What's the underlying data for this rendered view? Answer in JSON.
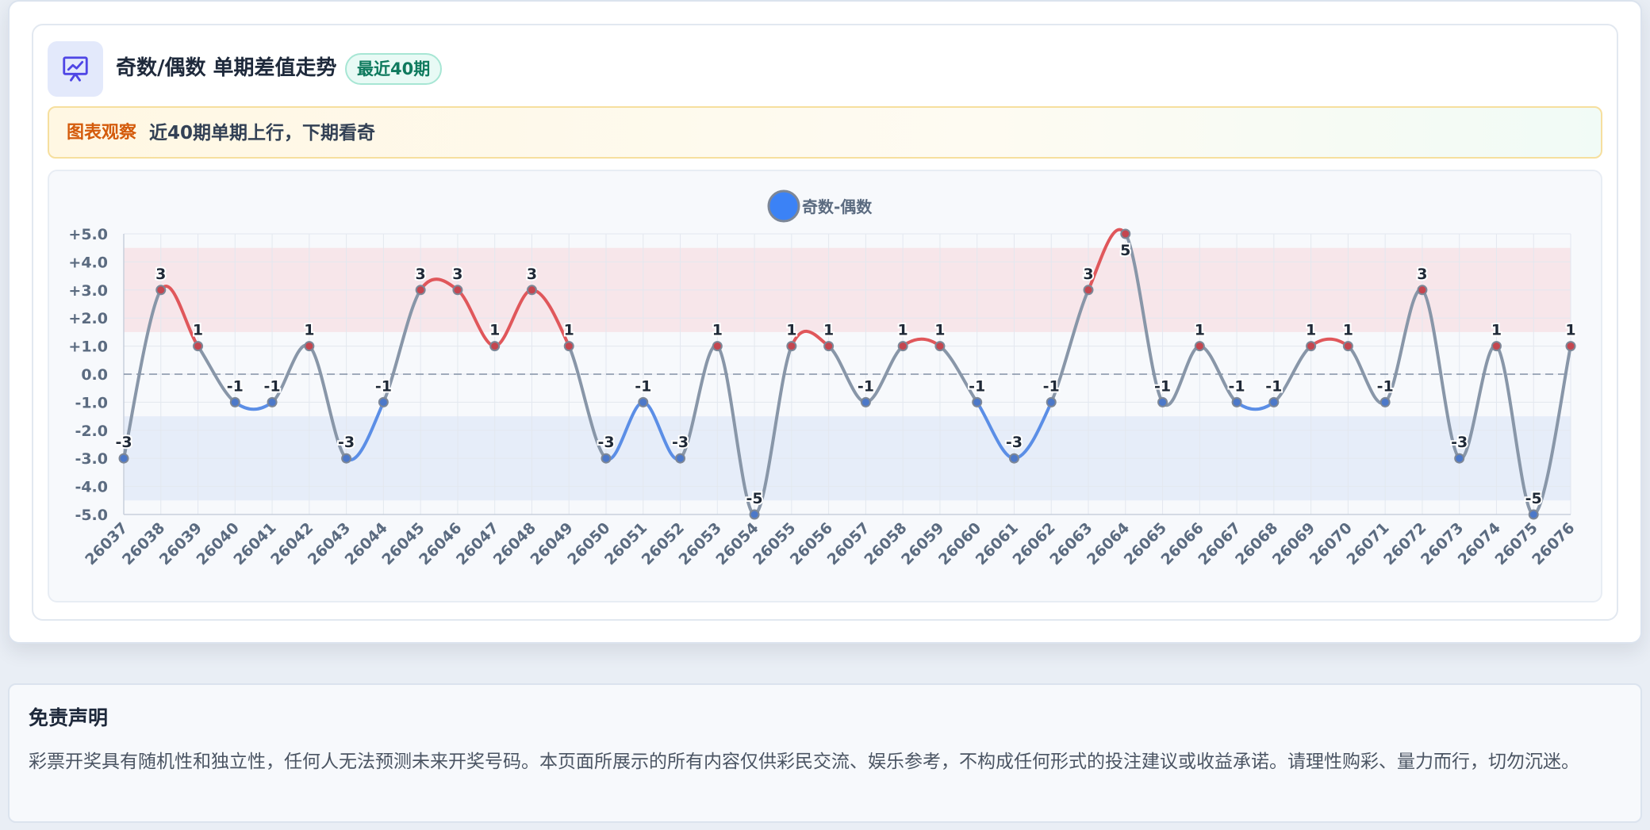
{
  "header": {
    "icon": "presentation-chart-icon",
    "title": "奇数/偶数 单期差值走势",
    "badge": "最近40期"
  },
  "insight": {
    "label": "图表观察",
    "text": "近40期单期上行，下期看奇"
  },
  "colors": {
    "up": "#e0575b",
    "down": "#5b8ee6",
    "neutral": "#8896a8",
    "legend": "#3b82f6",
    "upper_band": "#f7e6ea",
    "lower_band": "#e6edf9"
  },
  "chart_data": {
    "type": "line",
    "legend": "奇数-偶数",
    "legend_position": "top-center",
    "ylim": [
      -5,
      5
    ],
    "yticks": [
      "+5.0",
      "+4.0",
      "+3.0",
      "+2.0",
      "+1.0",
      "0.0",
      "-1.0",
      "-2.0",
      "-3.0",
      "-4.0",
      "-5.0"
    ],
    "upper_band": [
      1.5,
      4.5
    ],
    "lower_band": [
      -4.5,
      -1.5
    ],
    "zero_line": "dashed",
    "grid": true,
    "x": [
      "26037",
      "26038",
      "26039",
      "26040",
      "26041",
      "26042",
      "26043",
      "26044",
      "26045",
      "26046",
      "26047",
      "26048",
      "26049",
      "26050",
      "26051",
      "26052",
      "26053",
      "26054",
      "26055",
      "26056",
      "26057",
      "26058",
      "26059",
      "26060",
      "26061",
      "26062",
      "26063",
      "26064",
      "26065",
      "26066",
      "26067",
      "26068",
      "26069",
      "26070",
      "26071",
      "26072",
      "26073",
      "26074",
      "26075",
      "26076"
    ],
    "series": [
      {
        "name": "奇数-偶数",
        "values": [
          -3,
          3,
          1,
          -1,
          -1,
          1,
          -3,
          -1,
          3,
          3,
          1,
          3,
          1,
          -3,
          -1,
          -3,
          1,
          -5,
          1,
          1,
          -1,
          1,
          1,
          -1,
          -3,
          -1,
          3,
          5,
          -1,
          1,
          -1,
          -1,
          1,
          1,
          -1,
          3,
          -3,
          1,
          -5,
          1
        ]
      }
    ]
  },
  "disclaimer": {
    "title": "免责声明",
    "text": "彩票开奖具有随机性和独立性，任何人无法预测未来开奖号码。本页面所展示的所有内容仅供彩民交流、娱乐参考，不构成任何形式的投注建议或收益承诺。请理性购彩、量力而行，切勿沉迷。"
  }
}
